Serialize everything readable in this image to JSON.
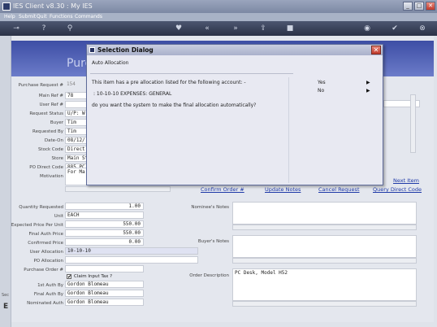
{
  "window": {
    "title": "IES Client v8.30 : My IES",
    "min_label": "_",
    "max_label": "□",
    "close_label": "✕"
  },
  "menu": [
    "Help",
    "Submit",
    "Quit",
    "Functions",
    "Commands"
  ],
  "toolbar_icons": [
    "key-icon",
    "help-icon",
    "search-icon",
    "heart-icon",
    "back-icon",
    "forward-icon",
    "upload-icon",
    "stop-icon",
    "globe-icon",
    "check-icon",
    "close-icon"
  ],
  "toolbar_glyphs": [
    "⊸",
    "?",
    "⚲",
    "♥",
    "«",
    "»",
    "⇪",
    "■",
    "◉",
    "✔",
    "⊗"
  ],
  "page": {
    "title_fragment": "Purc"
  },
  "form": {
    "labels": [
      "Purchase Request #",
      "Main Ref #",
      "User Ref #",
      "Request Status",
      "Buyer",
      "Requested By",
      "Date-On",
      "Stock Code",
      "Store",
      "PO Direct Code",
      "Motivation"
    ],
    "values": [
      "154",
      "78",
      "",
      "U/P: W",
      "Tim",
      "Tim",
      "08/12/",
      "Direct",
      "Main St",
      "885 PC",
      "For Ma"
    ]
  },
  "links": {
    "next_item": "Next Item",
    "confirm_order": "Confirm Order #",
    "update_notes": "Update Notes",
    "cancel_request": "Cancel Request",
    "query_direct_code": "Query Direct Code"
  },
  "lower": {
    "labels": [
      "Quantity Requested",
      "Unit",
      "Expected Price Per Unit",
      "Final Auth Price",
      "Confirmed Price",
      "User Allocation",
      "PO Allocation",
      "Purchase Order #"
    ],
    "values": [
      "1.00",
      "EACH",
      "550.00",
      "550.00",
      "0.00",
      "10-10-10",
      "",
      ""
    ],
    "claim_label": "Claim Input Tax ?",
    "claim_check": "✔",
    "auth_labels": [
      "1st Auth By",
      "Final Auth By",
      "Nominated Auth"
    ],
    "auth_values": [
      "Gordon Blomeau",
      "Gordon Blomeau",
      "Gordon Blomeau"
    ],
    "nominee_notes_label": "Nominee's Notes",
    "buyers_notes_label": "Buyer's Notes",
    "order_description_label": "Order Description",
    "order_description": "PC Desk, Model H52"
  },
  "dialog": {
    "title": "Selection Dialog",
    "subtitle": "Auto Allocation",
    "line1": "This item has a pre allocation listed for the following account: -",
    "line2": ": 10-10-10 EXPENSES: GENERAL",
    "line3": "do you want the system to make the final allocation automatically?",
    "options": [
      "Yes",
      "No"
    ],
    "option_arrow": "▶",
    "close_label": "✕"
  },
  "sidebar": {
    "letter": "E",
    "fragment": "Sec"
  }
}
